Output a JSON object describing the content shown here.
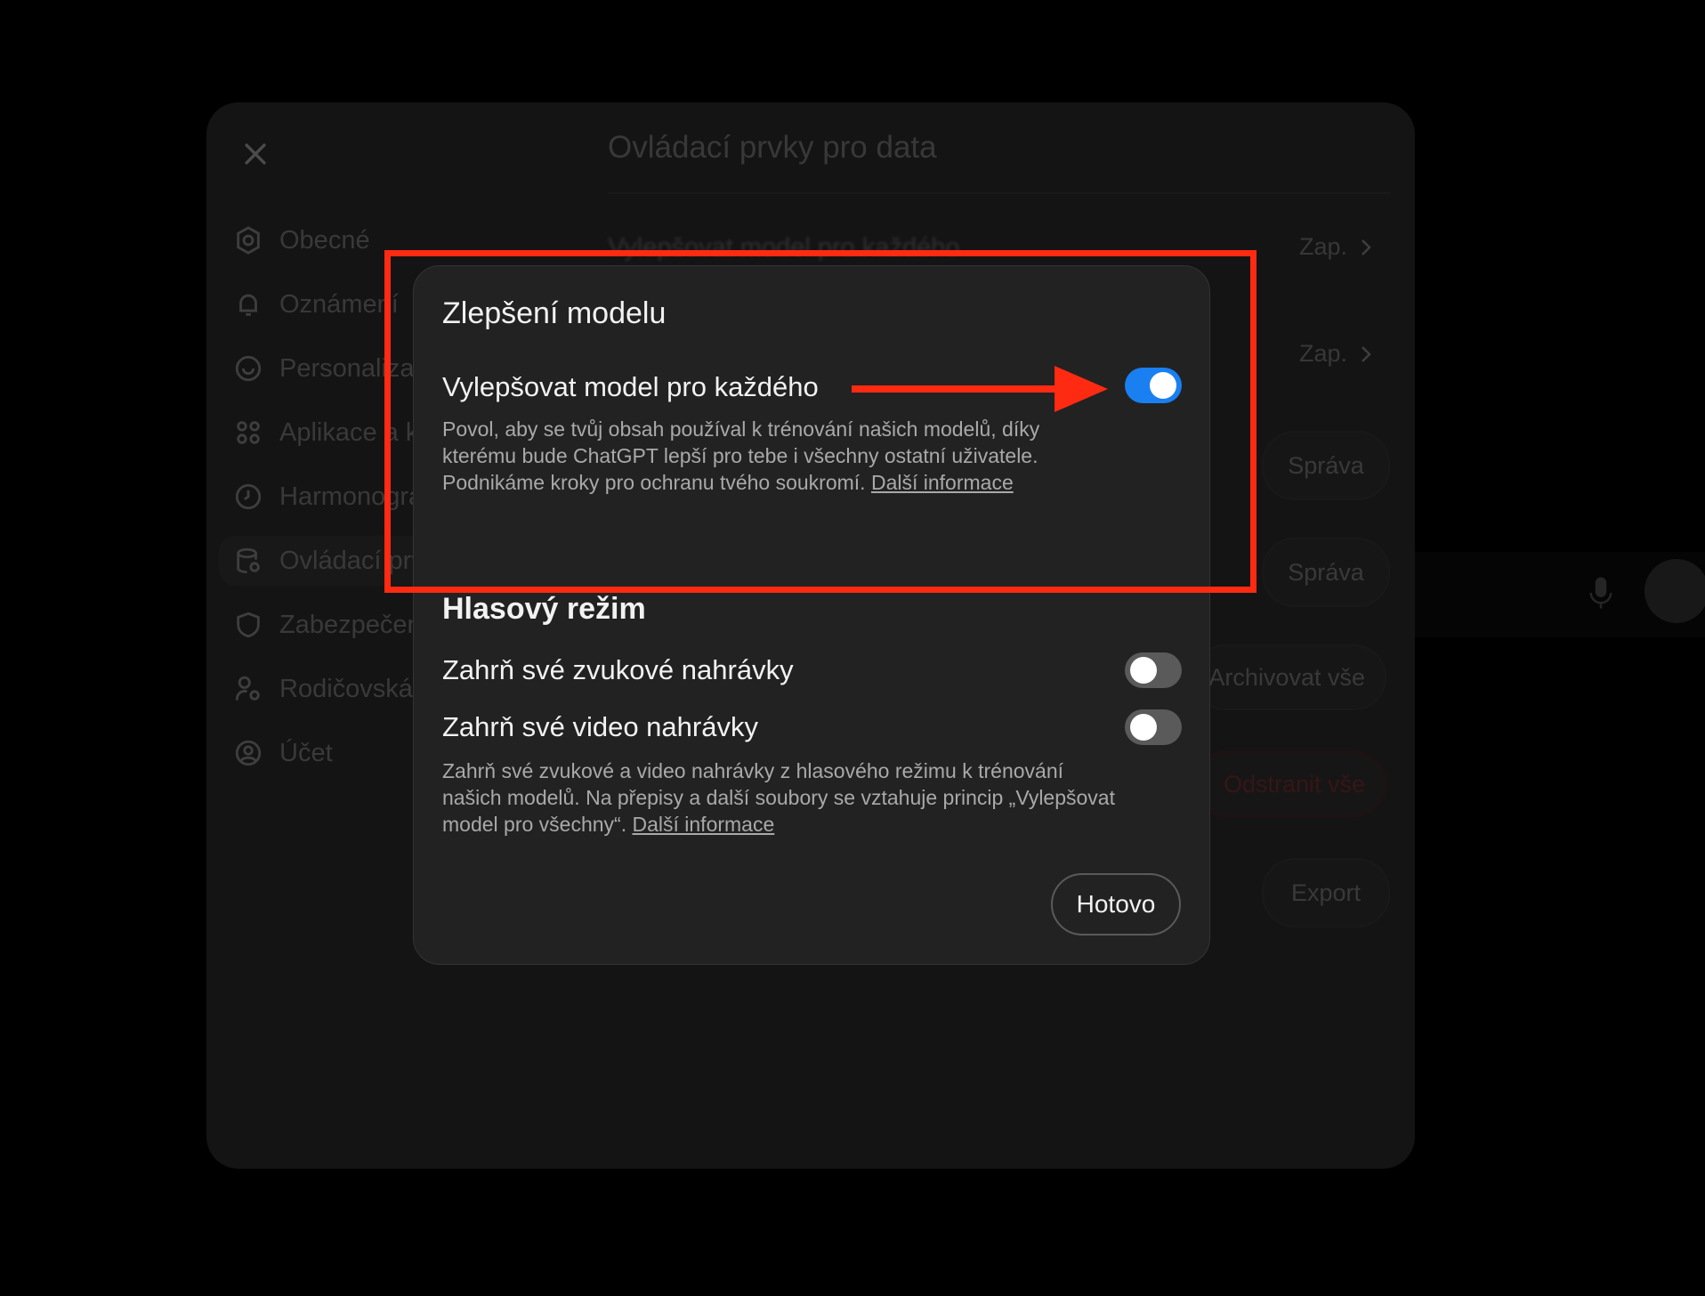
{
  "background": {
    "title": "Ovládací prvky pro data",
    "sidebar": [
      {
        "label": "Obecné",
        "icon": "gear-icon"
      },
      {
        "label": "Oznámení",
        "icon": "bell-icon"
      },
      {
        "label": "Personalizace",
        "icon": "personalization-icon"
      },
      {
        "label": "Aplikace a konektory",
        "icon": "apps-grid-icon"
      },
      {
        "label": "Harmonogramy",
        "icon": "clock-icon"
      },
      {
        "label": "Ovládací prvky pro data",
        "icon": "database-icon",
        "active": true
      },
      {
        "label": "Zabezpečení",
        "icon": "shield-icon"
      },
      {
        "label": "Rodičovská kontrola",
        "icon": "parental-icon"
      },
      {
        "label": "Účet",
        "icon": "account-icon"
      }
    ],
    "row1_label": "Vylepšovat model pro každého",
    "zap_label": "Zap.",
    "buttons": {
      "manage1": "Správa",
      "manage2": "Správa",
      "archive": "Archivovat vše",
      "delete": "Odstranit vše",
      "export": "Export"
    }
  },
  "modal": {
    "title": "Zlepšení modelu",
    "improve": {
      "label": "Vylepšovat model pro každého",
      "enabled": true,
      "desc": "Povol, aby se tvůj obsah používal k trénování našich modelů, díky kterému bude ChatGPT lepší pro tebe i všechny ostatní uživatele. Podnikáme kroky pro ochranu tvého soukromí.",
      "link": "Další informace"
    },
    "voice": {
      "title": "Hlasový režim",
      "audio_label": "Zahrň své zvukové nahrávky",
      "audio_enabled": false,
      "video_label": "Zahrň své video nahrávky",
      "video_enabled": false,
      "desc": "Zahrň své zvukové a video nahrávky z hlasového režimu k trénování našich modelů. Na přepisy a další soubory se vztahuje princip „Vylepšovat model pro všechny“.",
      "link": "Další informace"
    },
    "done_label": "Hotovo"
  },
  "annotation_color": "#ff2a12",
  "toggle_on_color": "#1a7ff0"
}
